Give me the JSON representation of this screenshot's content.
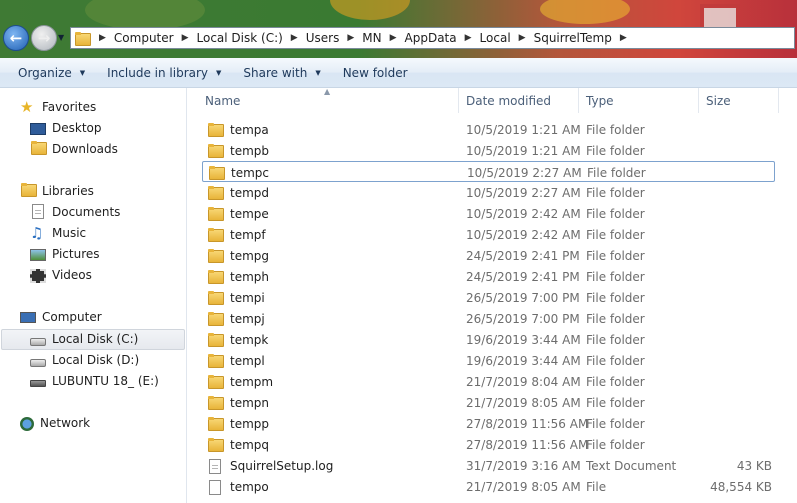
{
  "address": {
    "crumbs": [
      "Computer",
      "Local Disk (C:)",
      "Users",
      "MN",
      "AppData",
      "Local",
      "SquirrelTemp"
    ]
  },
  "commands": {
    "organize": "Organize",
    "include_in_library": "Include in library",
    "share_with": "Share with",
    "new_folder": "New folder"
  },
  "nav": {
    "favorites": "Favorites",
    "desktop": "Desktop",
    "downloads": "Downloads",
    "libraries": "Libraries",
    "documents": "Documents",
    "music": "Music",
    "pictures": "Pictures",
    "videos": "Videos",
    "computer": "Computer",
    "local_c": "Local Disk (C:)",
    "local_d": "Local Disk (D:)",
    "lubuntu": "LUBUNTU 18_ (E:)",
    "network": "Network"
  },
  "columns": {
    "name": "Name",
    "date": "Date modified",
    "type": "Type",
    "size": "Size"
  },
  "files": [
    {
      "name": "tempa",
      "date": "10/5/2019 1:21 AM",
      "type": "File folder",
      "size": "",
      "icon": "folder"
    },
    {
      "name": "tempb",
      "date": "10/5/2019 1:21 AM",
      "type": "File folder",
      "size": "",
      "icon": "folder"
    },
    {
      "name": "tempc",
      "date": "10/5/2019 2:27 AM",
      "type": "File folder",
      "size": "",
      "icon": "folder"
    },
    {
      "name": "tempd",
      "date": "10/5/2019 2:27 AM",
      "type": "File folder",
      "size": "",
      "icon": "folder"
    },
    {
      "name": "tempe",
      "date": "10/5/2019 2:42 AM",
      "type": "File folder",
      "size": "",
      "icon": "folder"
    },
    {
      "name": "tempf",
      "date": "10/5/2019 2:42 AM",
      "type": "File folder",
      "size": "",
      "icon": "folder"
    },
    {
      "name": "tempg",
      "date": "24/5/2019 2:41 PM",
      "type": "File folder",
      "size": "",
      "icon": "folder"
    },
    {
      "name": "temph",
      "date": "24/5/2019 2:41 PM",
      "type": "File folder",
      "size": "",
      "icon": "folder"
    },
    {
      "name": "tempi",
      "date": "26/5/2019 7:00 PM",
      "type": "File folder",
      "size": "",
      "icon": "folder"
    },
    {
      "name": "tempj",
      "date": "26/5/2019 7:00 PM",
      "type": "File folder",
      "size": "",
      "icon": "folder"
    },
    {
      "name": "tempk",
      "date": "19/6/2019 3:44 AM",
      "type": "File folder",
      "size": "",
      "icon": "folder"
    },
    {
      "name": "templ",
      "date": "19/6/2019 3:44 AM",
      "type": "File folder",
      "size": "",
      "icon": "folder"
    },
    {
      "name": "tempm",
      "date": "21/7/2019 8:04 AM",
      "type": "File folder",
      "size": "",
      "icon": "folder"
    },
    {
      "name": "tempn",
      "date": "21/7/2019 8:05 AM",
      "type": "File folder",
      "size": "",
      "icon": "folder"
    },
    {
      "name": "tempp",
      "date": "27/8/2019 11:56 AM",
      "type": "File folder",
      "size": "",
      "icon": "folder"
    },
    {
      "name": "tempq",
      "date": "27/8/2019 11:56 AM",
      "type": "File folder",
      "size": "",
      "icon": "folder"
    },
    {
      "name": "SquirrelSetup.log",
      "date": "31/7/2019 3:16 AM",
      "type": "Text Document",
      "size": "43 KB",
      "icon": "text-document"
    },
    {
      "name": "tempo",
      "date": "21/7/2019 8:05 AM",
      "type": "File",
      "size": "48,554 KB",
      "icon": "file"
    }
  ]
}
